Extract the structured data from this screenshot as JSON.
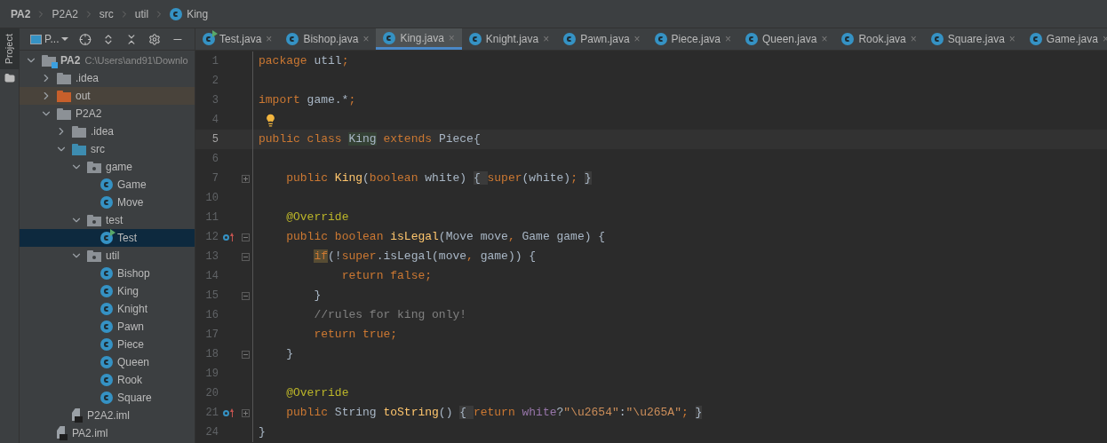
{
  "breadcrumb": [
    {
      "label": "PA2",
      "kind": "project"
    },
    {
      "label": "P2A2",
      "kind": "folder"
    },
    {
      "label": "src",
      "kind": "folder"
    },
    {
      "label": "util",
      "kind": "folder"
    },
    {
      "label": "King",
      "kind": "class"
    }
  ],
  "tool_strip": {
    "label": "Project"
  },
  "project_panel": {
    "view_label": "P...",
    "tree": [
      {
        "name": "PA2",
        "kind": "project",
        "path": "C:\\Users\\and91\\Downlo",
        "expanded": true,
        "selected": false,
        "children": [
          {
            "name": ".idea",
            "kind": "folder",
            "expanded": false,
            "selected": false
          },
          {
            "name": "out",
            "kind": "excluded",
            "expanded": false,
            "selected": false
          },
          {
            "name": "P2A2",
            "kind": "folder",
            "expanded": true,
            "selected": false,
            "children": [
              {
                "name": ".idea",
                "kind": "folder",
                "expanded": false,
                "selected": false
              },
              {
                "name": "src",
                "kind": "source",
                "expanded": true,
                "selected": false,
                "children": [
                  {
                    "name": "game",
                    "kind": "package",
                    "expanded": true,
                    "selected": false,
                    "children": [
                      {
                        "name": "Game",
                        "kind": "class",
                        "selected": false
                      },
                      {
                        "name": "Move",
                        "kind": "class",
                        "selected": false
                      }
                    ]
                  },
                  {
                    "name": "test",
                    "kind": "package",
                    "expanded": true,
                    "selected": false,
                    "children": [
                      {
                        "name": "Test",
                        "kind": "runclass",
                        "selected": true
                      }
                    ]
                  },
                  {
                    "name": "util",
                    "kind": "package",
                    "expanded": true,
                    "selected": false,
                    "children": [
                      {
                        "name": "Bishop",
                        "kind": "class",
                        "selected": false
                      },
                      {
                        "name": "King",
                        "kind": "class",
                        "selected": false
                      },
                      {
                        "name": "Knight",
                        "kind": "class",
                        "selected": false
                      },
                      {
                        "name": "Pawn",
                        "kind": "class",
                        "selected": false
                      },
                      {
                        "name": "Piece",
                        "kind": "class",
                        "selected": false
                      },
                      {
                        "name": "Queen",
                        "kind": "class",
                        "selected": false
                      },
                      {
                        "name": "Rook",
                        "kind": "class",
                        "selected": false
                      },
                      {
                        "name": "Square",
                        "kind": "class",
                        "selected": false
                      }
                    ]
                  }
                ]
              },
              {
                "name": "P2A2.iml",
                "kind": "file",
                "selected": false
              }
            ]
          },
          {
            "name": "PA2.iml",
            "kind": "file",
            "selected": false
          }
        ]
      }
    ]
  },
  "tabs": [
    {
      "label": "Test.java",
      "kind": "runclass",
      "selected": false,
      "close": "×"
    },
    {
      "label": "Bishop.java",
      "kind": "class",
      "selected": false,
      "close": "×"
    },
    {
      "label": "King.java",
      "kind": "class",
      "selected": true,
      "close": "×"
    },
    {
      "label": "Knight.java",
      "kind": "class",
      "selected": false,
      "close": "×"
    },
    {
      "label": "Pawn.java",
      "kind": "class",
      "selected": false,
      "close": "×"
    },
    {
      "label": "Piece.java",
      "kind": "class",
      "selected": false,
      "close": "×"
    },
    {
      "label": "Queen.java",
      "kind": "class",
      "selected": false,
      "close": "×"
    },
    {
      "label": "Rook.java",
      "kind": "class",
      "selected": false,
      "close": "×"
    },
    {
      "label": "Square.java",
      "kind": "class",
      "selected": false,
      "close": "×"
    },
    {
      "label": "Game.java",
      "kind": "class",
      "selected": false,
      "close": "×"
    }
  ],
  "code_lines": [
    {
      "number": "1",
      "current": false,
      "hint": false,
      "override": false,
      "tokens": [
        {
          "text": "package ",
          "kind": "keyword"
        },
        {
          "text": "util",
          "kind": "plain"
        },
        {
          "text": ";",
          "kind": "keyword"
        }
      ]
    },
    {
      "number": "2",
      "current": false,
      "hint": false,
      "override": false
    },
    {
      "number": "3",
      "current": false,
      "hint": false,
      "override": false,
      "tokens": [
        {
          "text": "import ",
          "kind": "keyword"
        },
        {
          "text": "game.*",
          "kind": "plain"
        },
        {
          "text": ";",
          "kind": "keyword"
        }
      ]
    },
    {
      "number": "4",
      "current": false,
      "hint": true,
      "override": false
    },
    {
      "number": "5",
      "current": true,
      "hint": false,
      "override": false,
      "tokens": [
        {
          "text": "public class ",
          "kind": "keyword"
        },
        {
          "text": "King",
          "kind": "declaration"
        },
        {
          "text": " extends ",
          "kind": "keyword"
        },
        {
          "text": "Piece{",
          "kind": "plain"
        }
      ]
    },
    {
      "number": "6",
      "current": false,
      "hint": false,
      "override": false
    },
    {
      "number": "7",
      "current": false,
      "hint": false,
      "override": false,
      "fold_marker": {
        "kind": "expand"
      },
      "tokens": [
        {
          "text": "    public ",
          "kind": "keyword"
        },
        {
          "text": "King",
          "kind": "method"
        },
        {
          "text": "(",
          "kind": "plain"
        },
        {
          "text": "boolean ",
          "kind": "keyword"
        },
        {
          "text": "white)",
          "kind": "plain"
        },
        {
          "text": " { ",
          "kind": "folded"
        },
        {
          "text": "super",
          "kind": "keyword"
        },
        {
          "text": "(white)",
          "kind": "plain"
        },
        {
          "text": ";",
          "kind": "keyword"
        },
        {
          "text": " }",
          "kind": "folded"
        }
      ]
    },
    {
      "number": "10",
      "current": false,
      "hint": false,
      "override": false
    },
    {
      "number": "11",
      "current": false,
      "hint": false,
      "override": false,
      "tokens": [
        {
          "text": "    @Override",
          "kind": "annotation"
        }
      ]
    },
    {
      "number": "12",
      "current": false,
      "hint": false,
      "override": true,
      "fold_marker": {
        "kind": "collapse"
      },
      "tokens": [
        {
          "text": "    public boolean ",
          "kind": "keyword"
        },
        {
          "text": "isLegal",
          "kind": "method"
        },
        {
          "text": "(Move move",
          "kind": "plain"
        },
        {
          "text": ", ",
          "kind": "keyword"
        },
        {
          "text": "Game game) {",
          "kind": "plain"
        }
      ]
    },
    {
      "number": "13",
      "current": false,
      "hint": false,
      "override": false,
      "fold_marker": {
        "kind": "collapse"
      },
      "tokens": [
        {
          "text": "        if",
          "kind": "matched"
        },
        {
          "text": "(!",
          "kind": "plain"
        },
        {
          "text": "super",
          "kind": "keyword"
        },
        {
          "text": ".isLegal(move",
          "kind": "plain"
        },
        {
          "text": ", ",
          "kind": "keyword"
        },
        {
          "text": "game)) {",
          "kind": "plain"
        }
      ]
    },
    {
      "number": "14",
      "current": false,
      "hint": false,
      "override": false,
      "tokens": [
        {
          "text": "            return false;",
          "kind": "keyword"
        }
      ]
    },
    {
      "number": "15",
      "current": false,
      "hint": false,
      "override": false,
      "fold_marker": {
        "kind": "end"
      },
      "tokens": [
        {
          "text": "        }",
          "kind": "plain"
        }
      ]
    },
    {
      "number": "16",
      "current": false,
      "hint": false,
      "override": false,
      "tokens": [
        {
          "text": "        //rules for king only!",
          "kind": "comment"
        }
      ]
    },
    {
      "number": "17",
      "current": false,
      "hint": false,
      "override": false,
      "tokens": [
        {
          "text": "        return true;",
          "kind": "keyword"
        }
      ]
    },
    {
      "number": "18",
      "current": false,
      "hint": false,
      "override": false,
      "fold_marker": {
        "kind": "end"
      },
      "tokens": [
        {
          "text": "    }",
          "kind": "plain"
        }
      ]
    },
    {
      "number": "19",
      "current": false,
      "hint": false,
      "override": false
    },
    {
      "number": "20",
      "current": false,
      "hint": false,
      "override": false,
      "tokens": [
        {
          "text": "    @Override",
          "kind": "annotation"
        }
      ]
    },
    {
      "number": "21",
      "current": false,
      "hint": false,
      "override": true,
      "fold_marker": {
        "kind": "expand"
      },
      "tokens": [
        {
          "text": "    public ",
          "kind": "keyword"
        },
        {
          "text": "String ",
          "kind": "plain"
        },
        {
          "text": "toString",
          "kind": "method"
        },
        {
          "text": "()",
          "kind": "plain"
        },
        {
          "text": " { ",
          "kind": "folded"
        },
        {
          "text": "return ",
          "kind": "keyword"
        },
        {
          "text": "white",
          "kind": "field"
        },
        {
          "text": "?",
          "kind": "plain"
        },
        {
          "text": "\"\\u2654\"",
          "kind": "string"
        },
        {
          "text": ":",
          "kind": "plain"
        },
        {
          "text": "\"\\u265A\"",
          "kind": "string"
        },
        {
          "text": ";",
          "kind": "keyword"
        },
        {
          "text": " }",
          "kind": "folded"
        }
      ]
    },
    {
      "number": "24",
      "current": false,
      "hint": false,
      "override": false,
      "tokens": [
        {
          "text": "}",
          "kind": "plain"
        }
      ]
    }
  ]
}
